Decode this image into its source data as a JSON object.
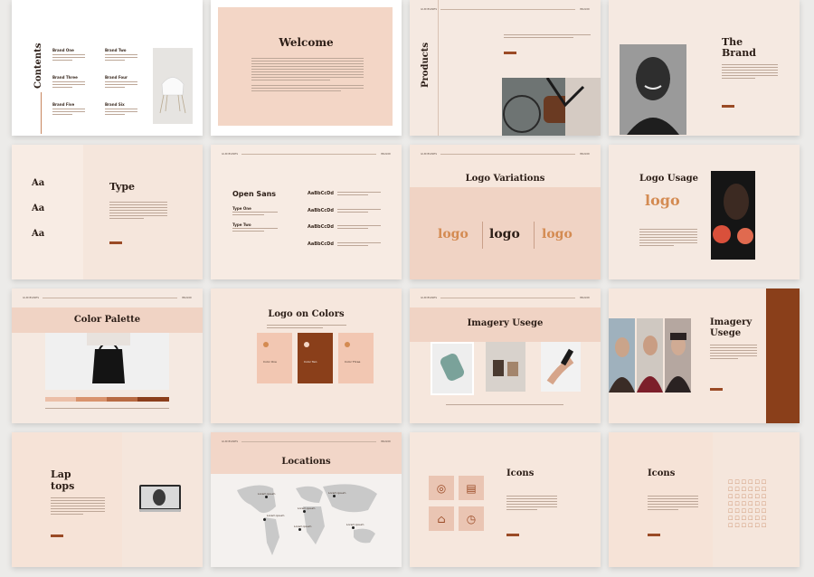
{
  "slides": {
    "contents": {
      "title": "Contents",
      "brands": [
        "Brand One",
        "Brand Two",
        "Brand Three",
        "Brand Four",
        "Brand Five",
        "Brand Six"
      ]
    },
    "welcome": {
      "title": "Welcome"
    },
    "products": {
      "title": "Products"
    },
    "brand": {
      "title_1": "The",
      "title_2": "Brand"
    },
    "type": {
      "title": "Type",
      "samples": [
        "Aa",
        "Aa",
        "Aa"
      ]
    },
    "opensans": {
      "title": "Open Sans",
      "samples": [
        "AaBbCcDd",
        "AaBbCcDd",
        "AaBbCcDd",
        "AaBbCcDd"
      ],
      "type_one": "Type One",
      "type_two": "Type Two"
    },
    "logo_variations": {
      "title": "Logo Variations",
      "logo_text": "logo"
    },
    "logo_usage": {
      "title": "Logo Usage",
      "logo_text": "logo"
    },
    "color_palette": {
      "title": "Color Palette",
      "swatches": [
        "#f3d5c6",
        "#ecbfa8",
        "#d9936d",
        "#b86a42",
        "#8c3e1b"
      ]
    },
    "logo_colors": {
      "title": "Logo on Colors",
      "cards": [
        "Color One",
        "Color Two",
        "Color Three"
      ]
    },
    "imagery_1": {
      "title": "Imagery Usege"
    },
    "imagery_2": {
      "title_1": "Imagery",
      "title_2": "Usege"
    },
    "laptops": {
      "title_1": "Lap",
      "title_2": "tops"
    },
    "locations": {
      "title": "Locations",
      "pins": [
        "Lorem ipsum",
        "Lorem ipsum",
        "Lorem ipsum",
        "Lorem ipsum",
        "Lorem ipsum",
        "Lorem ipsum"
      ]
    },
    "icons_1": {
      "title": "Icons"
    },
    "icons_2": {
      "title": "Icons"
    }
  },
  "header": {
    "left": "GUIDELINES",
    "right": "BRAND"
  }
}
